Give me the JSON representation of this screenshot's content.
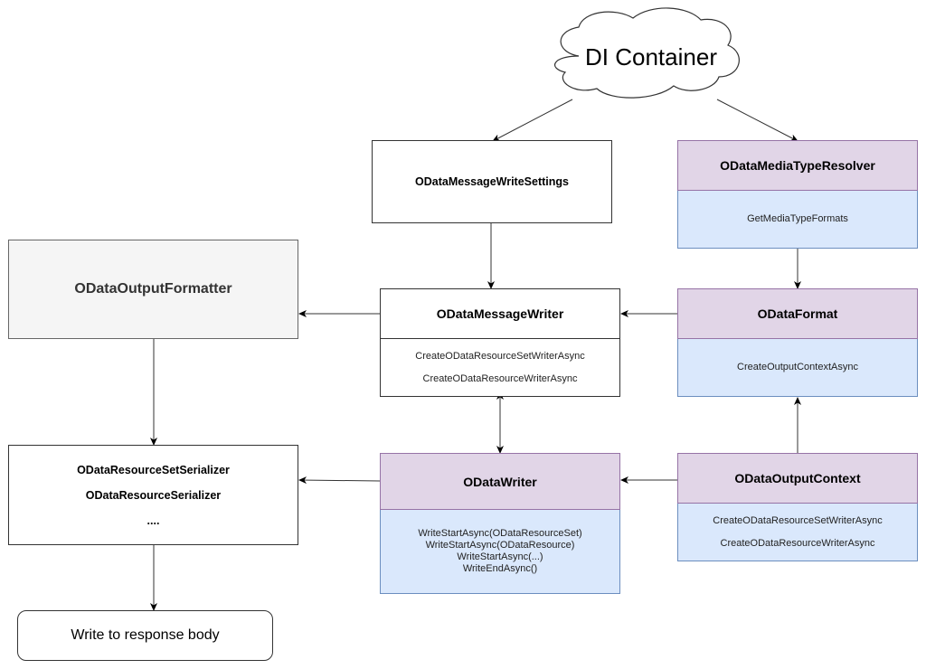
{
  "diagram": {
    "cloud": {
      "label": "DI Container",
      "icon": "cloud-shape"
    },
    "nodes": {
      "write_settings": {
        "title": "ODataMessageWriteSettings"
      },
      "media_type_resolver": {
        "title": "ODataMediaTypeResolver",
        "methods": [
          "GetMediaTypeFormats"
        ]
      },
      "output_formatter": {
        "title": "ODataOutputFormatter"
      },
      "message_writer": {
        "title": "ODataMessageWriter",
        "methods": [
          "CreateODataResourceSetWriterAsync",
          "CreateODataResourceWriterAsync"
        ]
      },
      "odata_format": {
        "title": "ODataFormat",
        "methods": [
          "CreateOutputContextAsync"
        ]
      },
      "serializers": {
        "lines": [
          "ODataResourceSetSerializer",
          "ODataResourceSerializer",
          "...."
        ]
      },
      "odata_writer": {
        "title": "ODataWriter",
        "methods": [
          "WriteStartAsync(ODataResourceSet)",
          "WriteStartAsync(ODataResource)",
          "WriteStartAsync(...)",
          "WriteEndAsync()"
        ]
      },
      "output_context": {
        "title": "ODataOutputContext",
        "methods": [
          "CreateODataResourceSetWriterAsync",
          "CreateODataResourceWriterAsync"
        ]
      },
      "response_body": {
        "title": "Write to response body"
      }
    },
    "edges": [
      {
        "from": "DI Container",
        "to": "ODataMessageWriteSettings"
      },
      {
        "from": "DI Container",
        "to": "ODataMediaTypeResolver"
      },
      {
        "from": "ODataMessageWriteSettings",
        "to": "ODataMessageWriter"
      },
      {
        "from": "ODataMediaTypeResolver",
        "to": "ODataFormat"
      },
      {
        "from": "ODataMessageWriter",
        "to": "ODataOutputFormatter"
      },
      {
        "from": "ODataFormat",
        "to": "ODataMessageWriter"
      },
      {
        "from": "ODataMessageWriter",
        "to": "ODataWriter",
        "bidirectional": true
      },
      {
        "from": "ODataOutputContext",
        "to": "ODataFormat"
      },
      {
        "from": "ODataOutputContext",
        "to": "ODataWriter"
      },
      {
        "from": "ODataWriter",
        "to": "Serializers"
      },
      {
        "from": "ODataOutputFormatter",
        "to": "Serializers"
      },
      {
        "from": "Serializers",
        "to": "Write to response body"
      }
    ],
    "colors": {
      "header_purple": "#e1d5e7",
      "header_purple_border": "#9673a6",
      "body_blue": "#dae8fc",
      "body_blue_border": "#6c8ebf",
      "formatter_gray": "#f5f5f5"
    }
  }
}
